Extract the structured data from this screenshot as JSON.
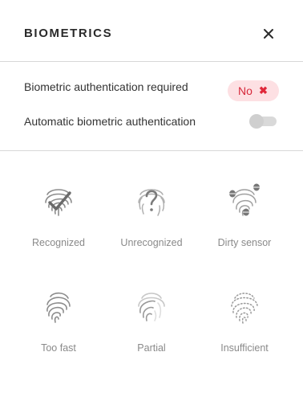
{
  "header": {
    "title": "BIOMETRICS",
    "close_icon": "close-icon"
  },
  "settings": {
    "required": {
      "label": "Biometric authentication required",
      "value": "No",
      "value_color": "#d6283a",
      "value_icon": "✖"
    },
    "automatic": {
      "label": "Automatic biometric authentication",
      "enabled": false
    }
  },
  "states": [
    {
      "label": "Recognized",
      "icon": "fingerprint-check-icon"
    },
    {
      "label": "Unrecognized",
      "icon": "fingerprint-question-icon"
    },
    {
      "label": "Dirty sensor",
      "icon": "fingerprint-bugs-icon"
    },
    {
      "label": "Too fast",
      "icon": "fingerprint-fast-icon"
    },
    {
      "label": "Partial",
      "icon": "fingerprint-partial-icon"
    },
    {
      "label": "Insufficient",
      "icon": "fingerprint-dotted-icon"
    }
  ]
}
